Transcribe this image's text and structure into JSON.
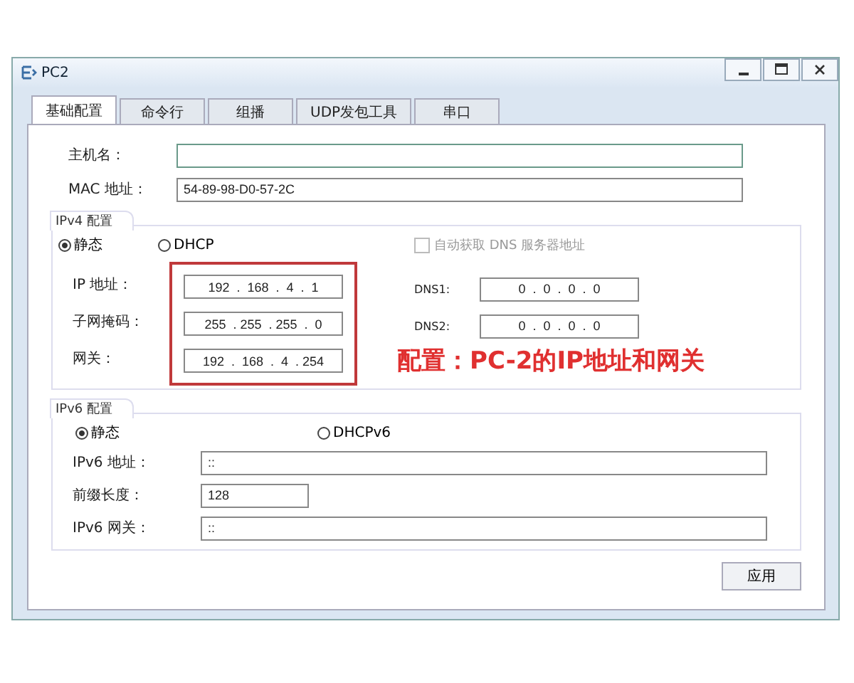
{
  "window": {
    "title": "PC2"
  },
  "tabs": [
    {
      "label": "基础配置",
      "selected": true
    },
    {
      "label": "命令行",
      "selected": false
    },
    {
      "label": "组播",
      "selected": false
    },
    {
      "label": "UDP发包工具",
      "selected": false
    },
    {
      "label": "串口",
      "selected": false
    }
  ],
  "host": {
    "label": "主机名："
  },
  "mac": {
    "label": "MAC 地址：",
    "value": "54-89-98-D0-57-2C"
  },
  "ipv4": {
    "title": "IPv4 配置",
    "modes": [
      {
        "label": "静态",
        "selected": true
      },
      {
        "label": "DHCP",
        "selected": false
      }
    ],
    "auto_dns": {
      "label": "自动获取 DNS 服务器地址",
      "checked": false,
      "disabled": true
    },
    "fields": [
      {
        "label": "IP 地址：",
        "value": "192  .  168  .  4  .  1"
      },
      {
        "label": "子网掩码：",
        "value": "255  . 255  . 255  .  0"
      },
      {
        "label": "网关：",
        "value": "192  .  168  .  4  . 254"
      }
    ],
    "dns": [
      {
        "label": "DNS1:",
        "value": "0  .  0  .  0  .  0"
      },
      {
        "label": "DNS2:",
        "value": "0  .  0  .  0  .  0"
      }
    ]
  },
  "ipv6": {
    "title": "IPv6 配置",
    "modes": [
      {
        "label": "静态",
        "selected": true
      },
      {
        "label": "DHCPv6",
        "selected": false
      }
    ],
    "fields": [
      {
        "label": "IPv6 地址：",
        "value": "::",
        "kind": "wide"
      },
      {
        "label": "前缀长度：",
        "value": "128",
        "kind": "short"
      },
      {
        "label": "IPv6 网关：",
        "value": "::",
        "kind": "wide"
      }
    ]
  },
  "apply_button": "应用",
  "annotation": {
    "text": "配置：PC-2的IP地址和网关"
  }
}
